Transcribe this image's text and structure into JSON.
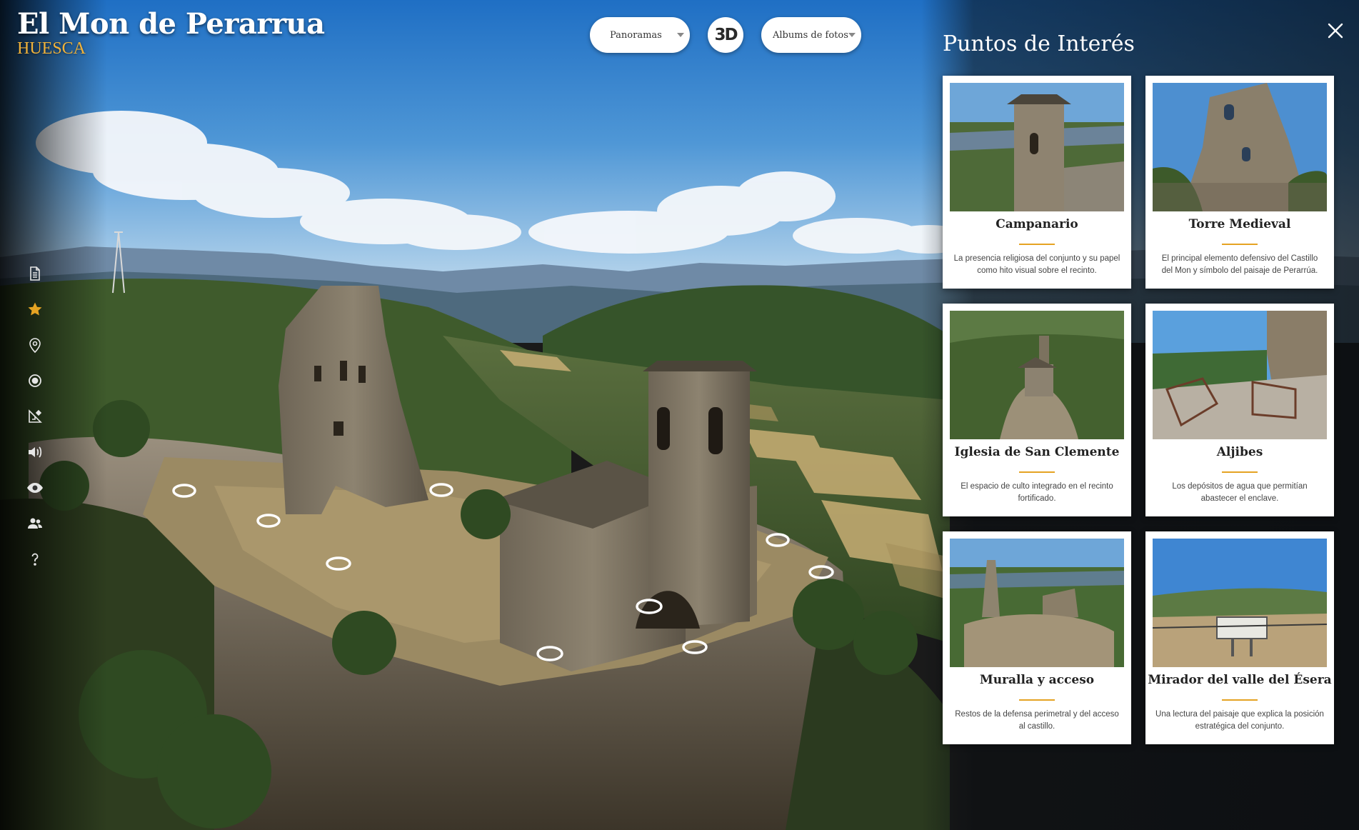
{
  "brand": {
    "title": "El Mon de Perarrua",
    "subtitle": "HUESCA"
  },
  "controls": {
    "panoramas_label": "Panoramas",
    "albums_label": "Albums de fotos",
    "view_3d_label": "3D"
  },
  "toolbar": {
    "icons": [
      "document-icon",
      "star-icon",
      "map-pin-icon",
      "target-icon",
      "measure-icon",
      "sound-icon",
      "eye-icon",
      "users-icon",
      "help-icon"
    ],
    "active_icon": "star-icon",
    "accent_color": "#e5a323"
  },
  "panel": {
    "title": "Puntos de Interés",
    "cards": [
      {
        "title": "Campanario",
        "description": "La presencia religiosa del conjunto y su papel como hito visual sobre el recinto."
      },
      {
        "title": "Torre Medieval",
        "description": "El principal elemento defensivo del Castillo del Mon y símbolo del paisaje de Perarrúa."
      },
      {
        "title": "Iglesia de San Clemente",
        "description": "El espacio de culto integrado en el recinto fortificado."
      },
      {
        "title": "Aljibes",
        "description": "Los depósitos de agua que permitían abastecer el enclave."
      },
      {
        "title": "Muralla y acceso",
        "description": "Restos de la defensa perimetral y del acceso al castillo."
      },
      {
        "title": "Mirador del valle del Ésera",
        "description": "Una lectura del paisaje que explica la posición estratégica del conjunto."
      }
    ]
  },
  "colors": {
    "accent": "#e5a323",
    "subtitle": "#f0b23a"
  }
}
